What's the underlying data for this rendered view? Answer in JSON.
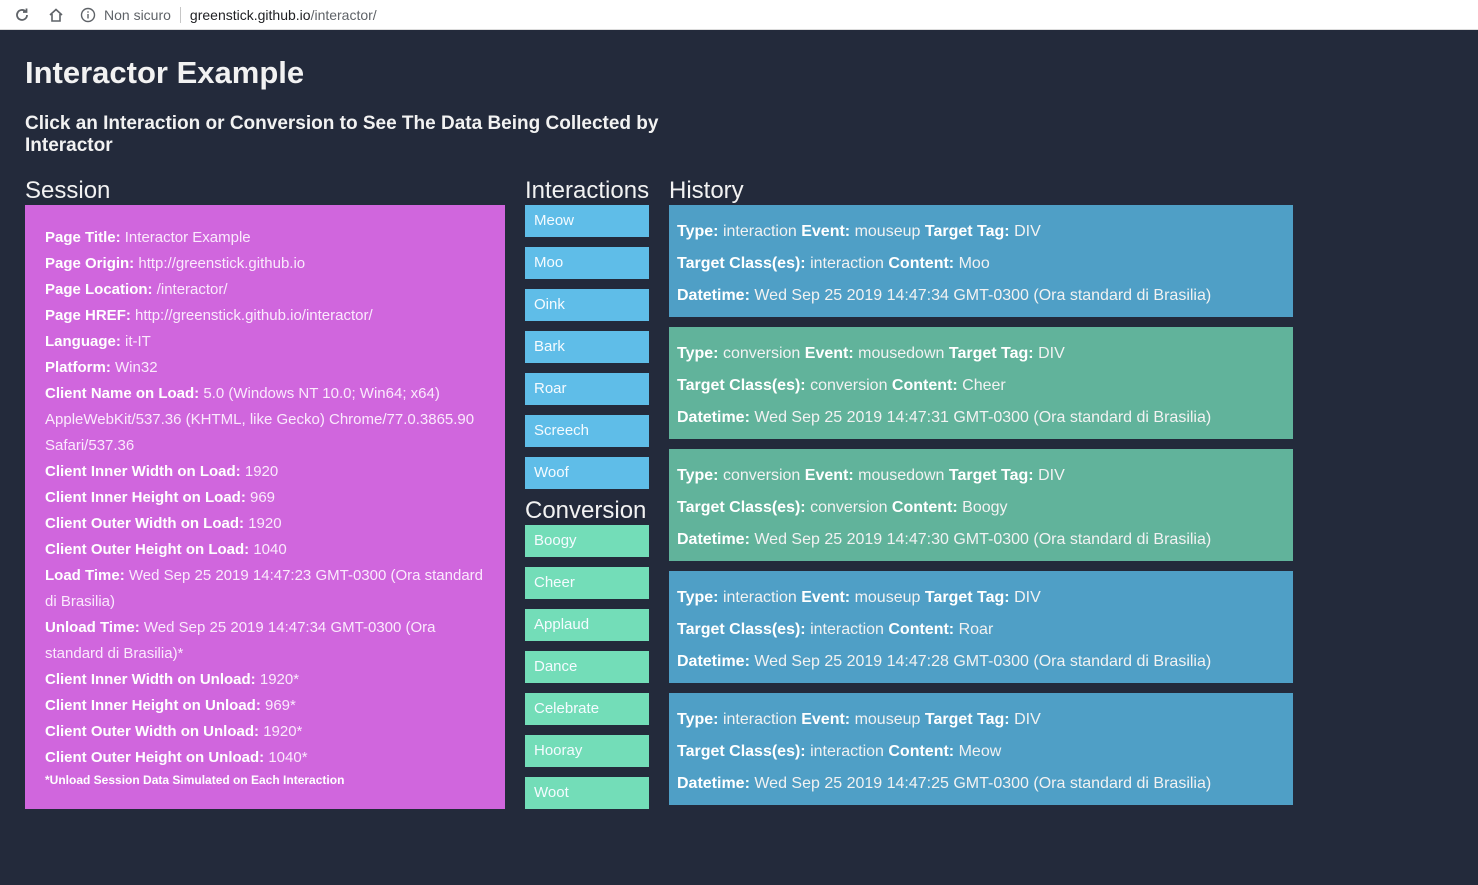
{
  "browser": {
    "security_label": "Non sicuro",
    "url_host": "greenstick.github.io",
    "url_path": "/interactor/"
  },
  "page": {
    "title": "Interactor Example",
    "subtitle": "Click an Interaction or Conversion to See The Data Being Collected by Interactor"
  },
  "session": {
    "heading": "Session",
    "rows": [
      {
        "label": "Page Title:",
        "value": "Interactor Example"
      },
      {
        "label": "Page Origin:",
        "value": "http://greenstick.github.io"
      },
      {
        "label": "Page Location:",
        "value": "/interactor/"
      },
      {
        "label": "Page HREF:",
        "value": "http://greenstick.github.io/interactor/"
      },
      {
        "label": "Language:",
        "value": "it-IT"
      },
      {
        "label": "Platform:",
        "value": "Win32"
      },
      {
        "label": "Client Name on Load:",
        "value": "5.0 (Windows NT 10.0; Win64; x64) AppleWebKit/537.36 (KHTML, like Gecko) Chrome/77.0.3865.90 Safari/537.36"
      },
      {
        "label": "Client Inner Width on Load:",
        "value": "1920"
      },
      {
        "label": "Client Inner Height on Load:",
        "value": "969"
      },
      {
        "label": "Client Outer Width on Load:",
        "value": "1920"
      },
      {
        "label": "Client Outer Height on Load:",
        "value": "1040"
      },
      {
        "label": "Load Time:",
        "value": "Wed Sep 25 2019 14:47:23 GMT-0300 (Ora standard di Brasilia)"
      },
      {
        "label": "Unload Time:",
        "value": "Wed Sep 25 2019 14:47:34 GMT-0300 (Ora standard di Brasilia)*"
      },
      {
        "label": "Client Inner Width on Unload:",
        "value": "1920*"
      },
      {
        "label": "Client Inner Height on Unload:",
        "value": "969*"
      },
      {
        "label": "Client Outer Width on Unload:",
        "value": "1920*"
      },
      {
        "label": "Client Outer Height on Unload:",
        "value": "1040*"
      }
    ],
    "note": "*Unload Session Data Simulated on Each Interaction"
  },
  "interactions": {
    "heading": "Interactions",
    "items": [
      "Meow",
      "Moo",
      "Oink",
      "Bark",
      "Roar",
      "Screech",
      "Woof"
    ]
  },
  "conversion": {
    "heading": "Conversion",
    "items": [
      "Boogy",
      "Cheer",
      "Applaud",
      "Dance",
      "Celebrate",
      "Hooray",
      "Woot"
    ]
  },
  "history": {
    "heading": "History",
    "labels": {
      "type": "Type:",
      "event": "Event:",
      "target_tag": "Target Tag:",
      "target_class": "Target Class(es):",
      "content": "Content:",
      "datetime": "Datetime:"
    },
    "entries": [
      {
        "type": "interaction",
        "event": "mouseup",
        "tag": "DIV",
        "class": "interaction",
        "content": "Moo",
        "datetime": "Wed Sep 25 2019 14:47:34 GMT-0300 (Ora standard di Brasilia)"
      },
      {
        "type": "conversion",
        "event": "mousedown",
        "tag": "DIV",
        "class": "conversion",
        "content": "Cheer",
        "datetime": "Wed Sep 25 2019 14:47:31 GMT-0300 (Ora standard di Brasilia)"
      },
      {
        "type": "conversion",
        "event": "mousedown",
        "tag": "DIV",
        "class": "conversion",
        "content": "Boogy",
        "datetime": "Wed Sep 25 2019 14:47:30 GMT-0300 (Ora standard di Brasilia)"
      },
      {
        "type": "interaction",
        "event": "mouseup",
        "tag": "DIV",
        "class": "interaction",
        "content": "Roar",
        "datetime": "Wed Sep 25 2019 14:47:28 GMT-0300 (Ora standard di Brasilia)"
      },
      {
        "type": "interaction",
        "event": "mouseup",
        "tag": "DIV",
        "class": "interaction",
        "content": "Meow",
        "datetime": "Wed Sep 25 2019 14:47:25 GMT-0300 (Ora standard di Brasilia)"
      }
    ]
  },
  "colors": {
    "background": "#232a3b",
    "session_panel": "#d066dd",
    "interaction_button": "#5fbde8",
    "conversion_button": "#73ddb8",
    "interaction_card": "#4f9fc6",
    "conversion_card": "#61b39b"
  },
  "icons": [
    "reload-icon",
    "home-icon",
    "info-icon"
  ]
}
